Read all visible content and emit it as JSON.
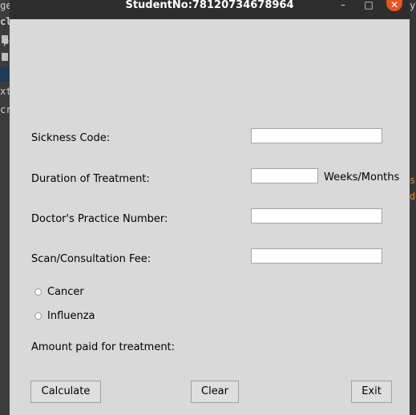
{
  "window": {
    "title": "StudentNo:78120734678964",
    "controls": {
      "minimize": "–",
      "maximize": "□",
      "close": "✕"
    }
  },
  "background": {
    "left_fragments": [
      "ge",
      "cl",
      "p",
      "xt",
      "cr"
    ],
    "right_fragments": [
      "y",
      "s",
      "d"
    ]
  },
  "form": {
    "sickness_code_label": "Sickness Code:",
    "sickness_code_value": "",
    "duration_label": "Duration of Treatment:",
    "duration_value": "",
    "duration_unit": "Weeks/Months",
    "practice_number_label": "Doctor's Practice Number:",
    "practice_number_value": "",
    "fee_label": "Scan/Consultation Fee:",
    "fee_value": "",
    "radio_options": [
      "Cancer",
      "Influenza"
    ],
    "amount_label": "Amount paid for treatment:"
  },
  "buttons": {
    "calculate": "Calculate",
    "clear": "Clear",
    "exit": "Exit"
  },
  "colors": {
    "window_bg": "#d9d9d9",
    "titlebar_bg": "#2e2e2e",
    "close_button": "#e95420"
  }
}
